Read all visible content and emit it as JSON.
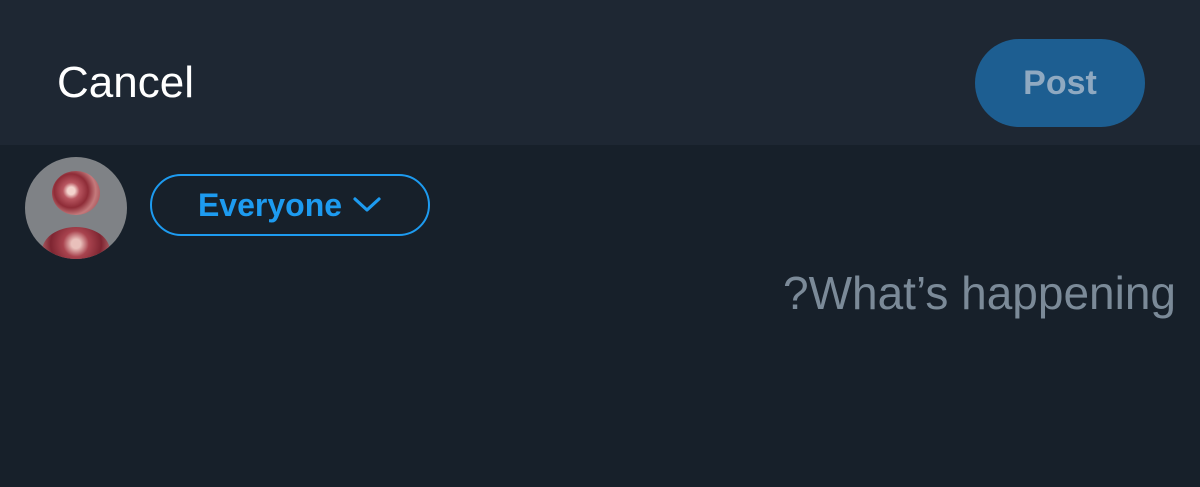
{
  "header": {
    "cancel_label": "Cancel",
    "post_label": "Post"
  },
  "composer": {
    "audience_label": "Everyone",
    "placeholder": "?What’s happening",
    "value": ""
  },
  "colors": {
    "accent": "#1d9bf0",
    "post_button_bg": "#1d5e91",
    "background": "#17202a",
    "topbar_bg": "#1e2733"
  },
  "icons": {
    "audience_dropdown": "chevron-down-icon",
    "avatar": "user-avatar"
  }
}
